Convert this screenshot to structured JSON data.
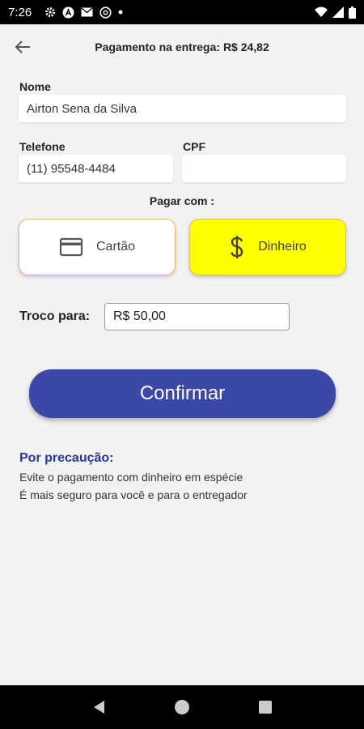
{
  "status_bar": {
    "time": "7:26",
    "icons_left": [
      "gear-icon",
      "a-circle-icon",
      "mail-icon",
      "at-circle-icon",
      "dot-icon"
    ],
    "icons_right": [
      "wifi-icon",
      "signal-icon",
      "battery-icon"
    ]
  },
  "header": {
    "title": "Pagamento na entrega: R$ 24,82"
  },
  "form": {
    "nome_label": "Nome",
    "nome_value": "Airton Sena da Silva",
    "telefone_label": "Telefone",
    "telefone_value": "(11) 95548-4484",
    "cpf_label": "CPF",
    "cpf_value": ""
  },
  "payment": {
    "label": "Pagar com :",
    "card_label": "Cartão",
    "cash_label": "Dinheiro",
    "selected": "Dinheiro",
    "colors": {
      "selected_bg": "#ffff00",
      "unselected_bg": "#ffffff",
      "border": "#f0b56a"
    }
  },
  "troco": {
    "label": "Troco para:",
    "value": "R$ 50,00"
  },
  "confirm": {
    "label": "Confirmar",
    "color": "#3c48a8"
  },
  "note": {
    "title": "Por precaução:",
    "line1": "Evite o pagamento com dinheiro em espécie",
    "line2": "É mais seguro para você e para o entregador"
  }
}
